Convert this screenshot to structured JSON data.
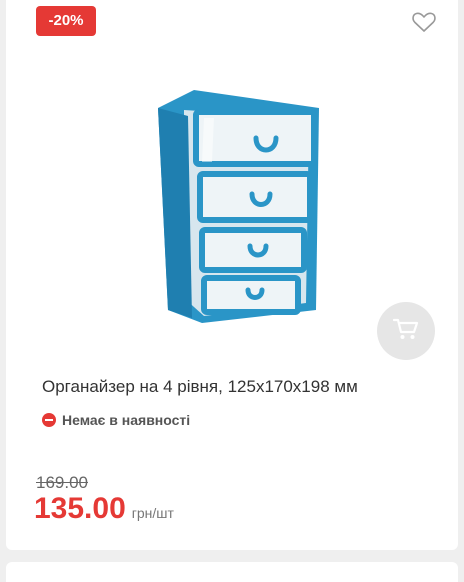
{
  "badge": {
    "discount": "-20%"
  },
  "icons": {
    "favorite": "heart-outline-icon",
    "cart": "shopping-cart-icon",
    "status": "minus-circle-icon"
  },
  "product": {
    "title": "Органайзер на 4 рівня, 125х170х198 мм",
    "availability": "Немає в наявності",
    "old_price": "169.00",
    "price": "135.00",
    "unit": "грн/шт"
  },
  "colors": {
    "accent": "#e53935",
    "organizer_frame": "#2a95c7",
    "cart_button_bg": "#e6e6e6"
  }
}
